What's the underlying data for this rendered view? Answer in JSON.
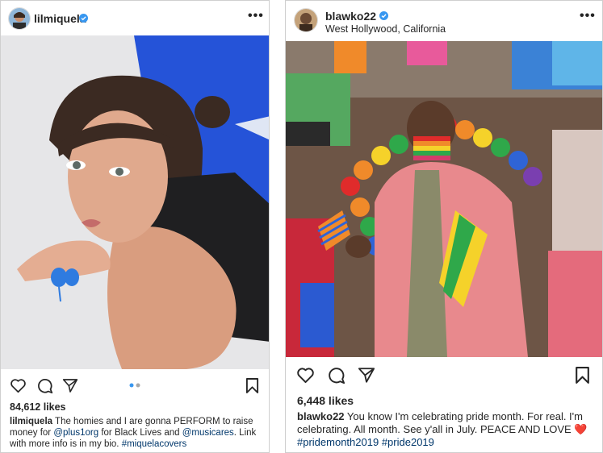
{
  "left_post": {
    "username": "lilmiquela",
    "more_icon": "more-horizontal-icon",
    "likes": "84,612 likes",
    "caption": {
      "username": "lilmiquela",
      "text_1": "The homies and I are gonna PERFORM to raise money for",
      "mention_1": "@plus1org",
      "text_2": "for Black Lives and",
      "mention_2": "@musicares",
      "text_3": ". Link with more info is in my bio.",
      "hashtag": "#miquelacovers"
    },
    "carousel": {
      "count": 2,
      "active": 1
    },
    "colors": {
      "background_blue": "#2553d8",
      "wall": "#e9e9eb"
    }
  },
  "right_post": {
    "username": "blawko22",
    "location": "West Hollywood, California",
    "more_icon": "more-horizontal-icon",
    "likes": "6,448 likes",
    "caption": {
      "username": "blawko22",
      "text_1": "You know I'm celebrating pride month. For real. I'm celebrating. All month. See y'all in July. PEACE AND LOVE",
      "emoji": "❤️",
      "hashtag_1": "#pridemonth2019",
      "hashtag_2": "#pride2019"
    }
  },
  "icons": {
    "like": "heart-icon",
    "comment": "comment-icon",
    "share": "paper-plane-icon",
    "save": "bookmark-icon",
    "verified": "verified-badge-icon"
  },
  "colors": {
    "verified_blue": "#3897f0",
    "link_blue": "#00376b",
    "carousel_active": "#3897f0",
    "carousel_inactive": "#a8a8a8"
  }
}
